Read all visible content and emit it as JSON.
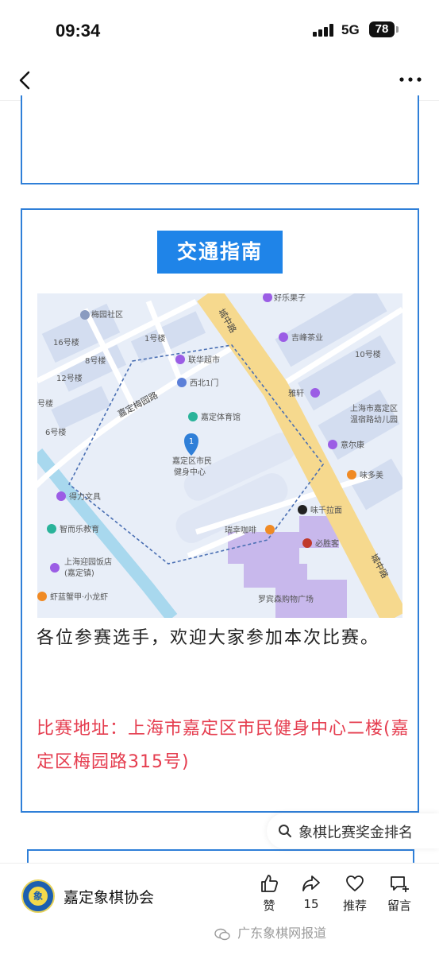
{
  "status_bar": {
    "time": "09:34",
    "network": "5G",
    "battery": "78"
  },
  "card": {
    "heading": "交通指南",
    "intro": "各位参赛选手，欢迎大家参加本次比赛。",
    "address": "比赛地址：上海市嘉定区市民健身中心二楼(嘉定区梅园路315号)"
  },
  "map": {
    "pin_number": "1",
    "labels": {
      "meiyuan_community": "梅园社区",
      "haoleguozi": "好乐果子",
      "b16": "16号楼",
      "b1": "1号楼",
      "b8": "8号楼",
      "b12": "12号楼",
      "b10": "10号楼",
      "b6": "6号楼",
      "b5": "号楼",
      "chengzhong_road_1": "城中路",
      "chengzhong_road_2": "城中路",
      "jiading_meiyuan_road": "嘉定梅园路",
      "lianhua": "联华超市",
      "xibei_gate": "西北1门",
      "stadium": "嘉定体育馆",
      "fitness_center_1": "嘉定区市民",
      "fitness_center_2": "健身中心",
      "jifeng": "吉峰茶业",
      "yaxuan": "雅轩",
      "kindergarten_1": "上海市嘉定区",
      "kindergarten_2": "温宿路幼儿园",
      "yierkang": "意尔康",
      "weiduomei": "味多美",
      "deli": "得力文具",
      "zhierle": "智而乐教育",
      "weiqian": "味千拉面",
      "ruixing": "瑞幸咖啡",
      "bishengke": "必胜客",
      "yingyuan_1": "上海迎园饭店",
      "yingyuan_2": "(嘉定镇)",
      "xiajian": "虾蓝蟹甲·小龙虾",
      "luobinsen": "罗宾森购物广场"
    }
  },
  "search_tip": "象棋比赛奖金排名",
  "footer": {
    "account_name": "嘉定象棋协会",
    "logo_char": "象",
    "actions": [
      {
        "icon": "thumbs-up-icon",
        "label": "赞"
      },
      {
        "icon": "share-icon",
        "label": "15"
      },
      {
        "icon": "heart-icon",
        "label": "推荐"
      },
      {
        "icon": "comment-icon",
        "label": "留言"
      }
    ]
  },
  "watermark": "广东象棋网报道"
}
